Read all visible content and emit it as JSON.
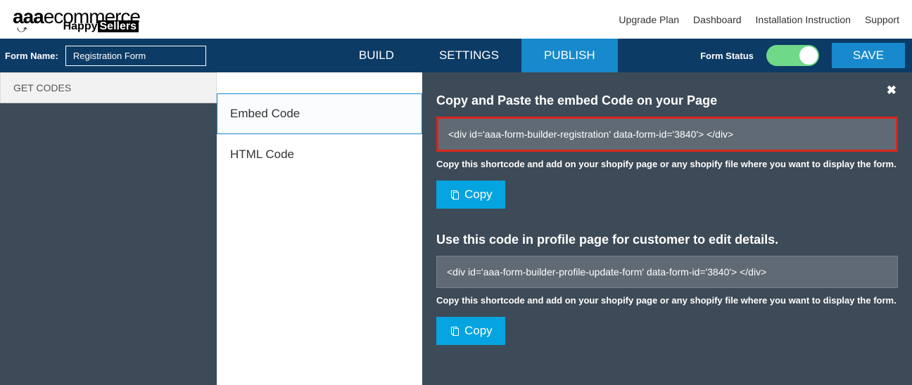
{
  "logo": {
    "aaa": "aaa",
    "ecommerce": "ecommerce",
    "happy": "Happy",
    "sellers": "Sellers"
  },
  "top_nav": {
    "upgrade": "Upgrade Plan",
    "dashboard": "Dashboard",
    "installation": "Installation Instruction",
    "support": "Support"
  },
  "form_name": {
    "label": "Form Name:",
    "value": "Registration Form"
  },
  "tabs": {
    "build": "BUILD",
    "settings": "SETTINGS",
    "publish": "PUBLISH"
  },
  "form_status": {
    "label": "Form Status",
    "save": "SAVE"
  },
  "sidebar": {
    "get_codes": "GET CODES"
  },
  "code_types": {
    "embed": "Embed Code",
    "html": "HTML Code"
  },
  "panel": {
    "close": "✖",
    "heading1": "Copy and Paste the embed Code on your Page",
    "code1": "<div id='aaa-form-builder-registration' data-form-id='3840'> </div>",
    "hint1": "Copy this shortcode and add on your shopify page or any shopify file where you want to display the form.",
    "copy1": "Copy",
    "heading2": "Use this code in profile page for customer to edit details.",
    "code2": "<div id='aaa-form-builder-profile-update-form' data-form-id='3840'> </div>",
    "hint2": "Copy this shortcode and add on your shopify page or any shopify file where you want to display the form.",
    "copy2": "Copy"
  }
}
